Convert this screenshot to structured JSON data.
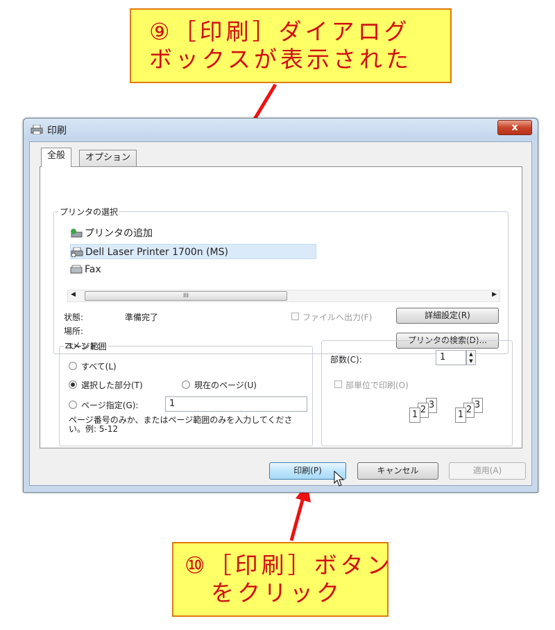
{
  "callouts": {
    "top": [
      "⑨［印刷］ダイアログ",
      "ボックスが表示された"
    ],
    "bottom": [
      "⑩［印刷］ボタン",
      "をクリック"
    ]
  },
  "window": {
    "title": "印刷",
    "close_label": "x",
    "tabs": [
      "全般",
      "オプション"
    ],
    "printer_group": {
      "legend": "プリンタの選択",
      "printers": [
        "プリンタの追加",
        "Dell Laser Printer 1700n (MS)",
        "Fax"
      ],
      "scroll_grip": "III",
      "status_label": "状態:",
      "status_value": "準備完了",
      "location_label": "場所:",
      "comment_label": "コメント:",
      "print_to_file": "ファイルへ出力(F)",
      "preferences_button": "詳細設定(R)",
      "find_printer_button": "プリンタの検索(D)..."
    },
    "range_group": {
      "legend": "ページ範囲",
      "all": "すべて(L)",
      "selection": "選択した部分(T)",
      "current_page": "現在のページ(U)",
      "pages": "ページ指定(G):",
      "pages_value": "1",
      "hint": "ページ番号のみか、またはページ範囲のみを入力してください。例: 5-12"
    },
    "copies_group": {
      "copies_label": "部数(C):",
      "copies_value": "1",
      "collate": "部単位で印刷(O)",
      "collate_pages": [
        "1",
        "2",
        "3"
      ]
    },
    "buttons": {
      "print": "印刷(P)",
      "cancel": "キャンセル",
      "apply": "適用(A)"
    }
  },
  "colors": {
    "callout_fill": "#ffff66",
    "callout_text": "#d01010",
    "arrow": "#ee1111"
  }
}
